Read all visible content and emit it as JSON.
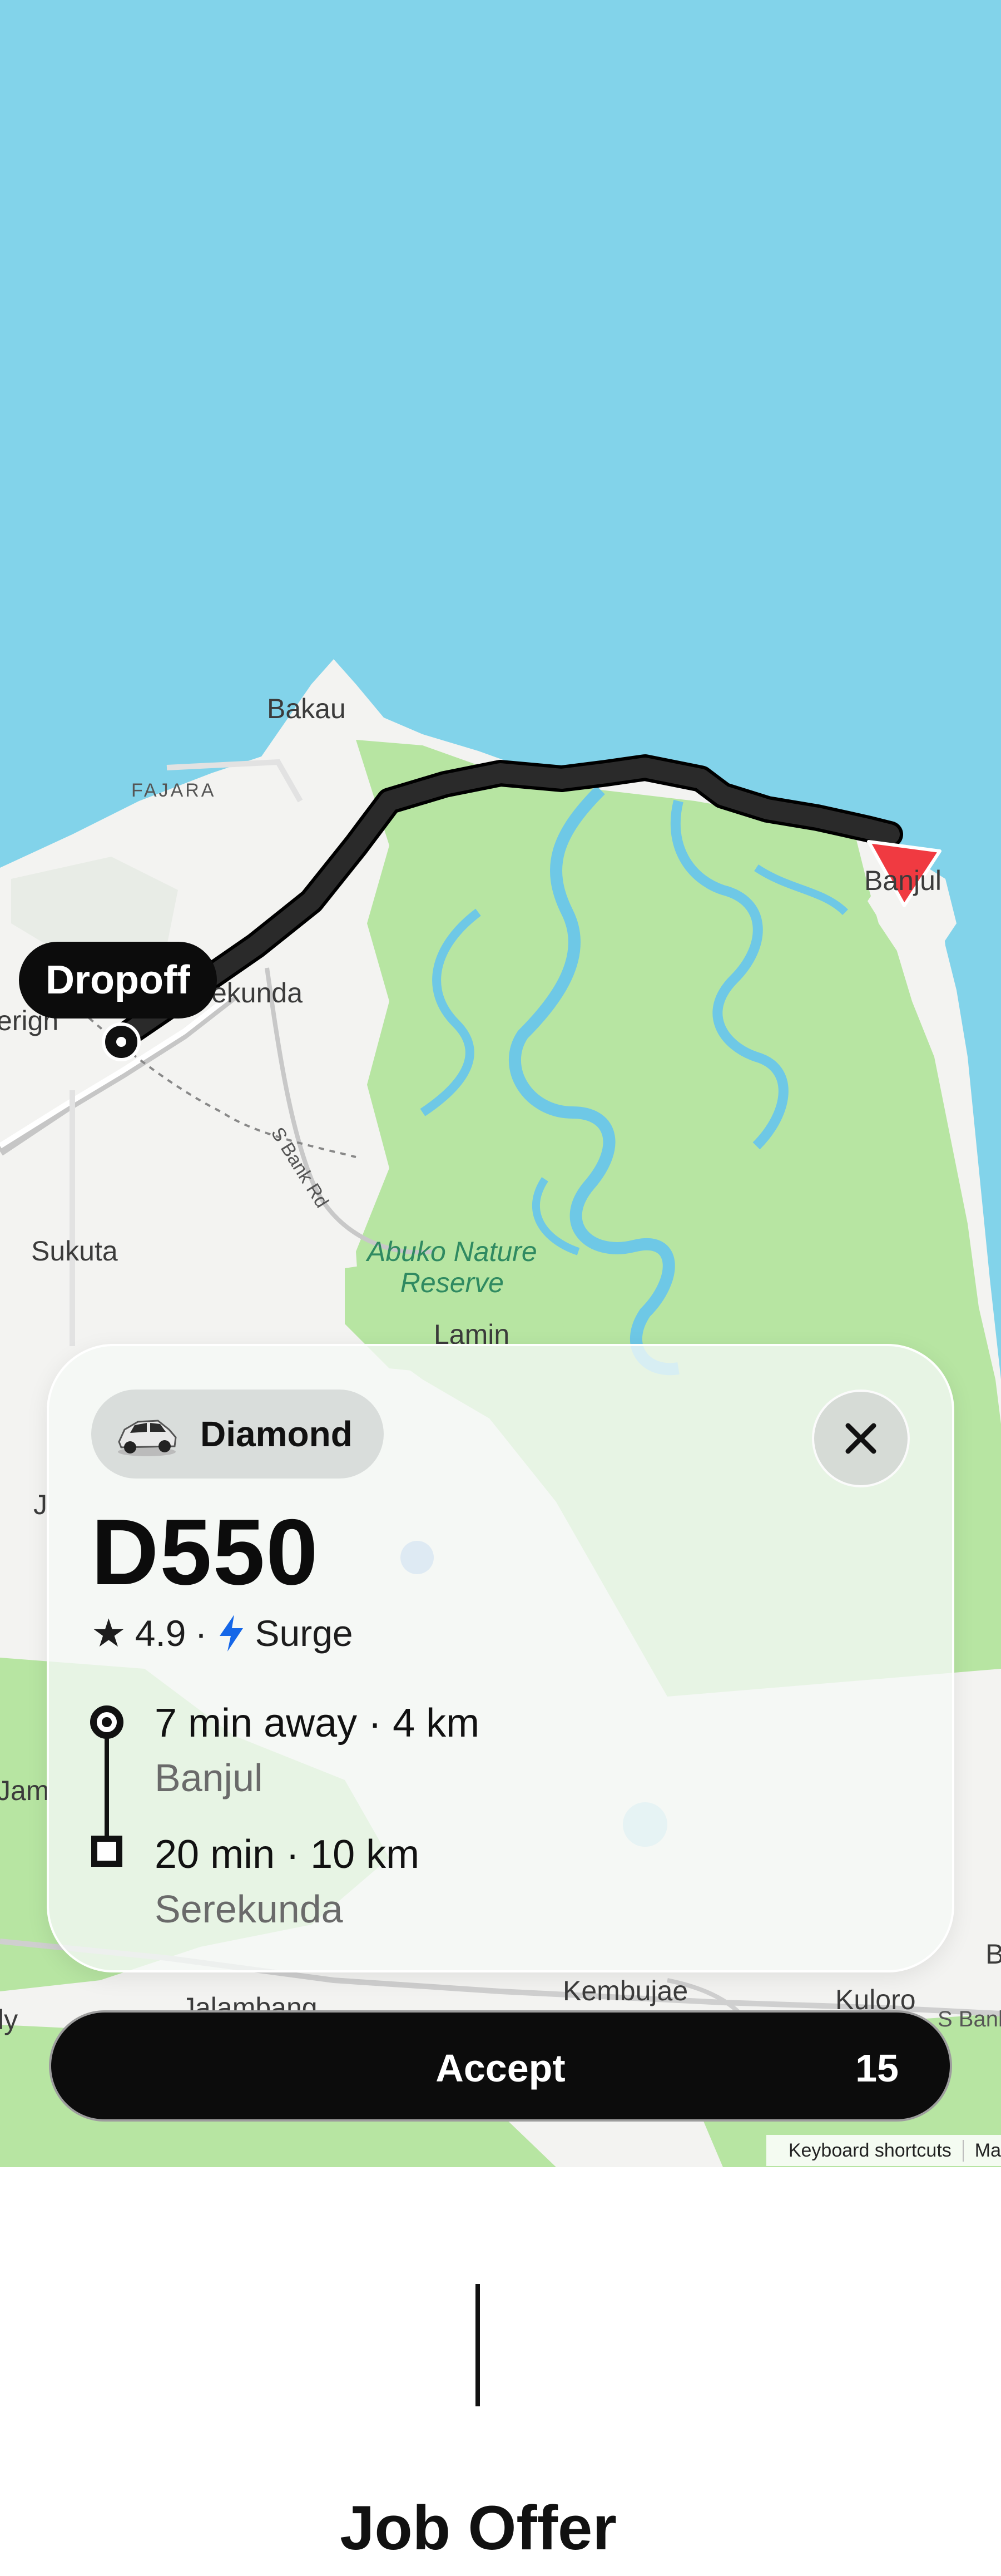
{
  "map": {
    "places": {
      "bakau": "Bakau",
      "fajara": "FAJARA",
      "serekunda_partial": "ekunda",
      "brikama_partial": "erigh",
      "banjul": "Banjul",
      "sukuta": "Sukuta",
      "abuko": "Abuko Nature\nReserve",
      "lamin": "Lamin",
      "kembujae": "Kembujae",
      "kuloro": "Kuloro",
      "jalambang": "Jalambang",
      "left_j": "J",
      "left_jam": "Jam",
      "left_ly": "ly",
      "right_b": "B",
      "road_sbank": "S Bank Rd",
      "road_sbank2": "S Bank"
    },
    "dropoff_label": "Dropoff",
    "footer": {
      "shortcuts": "Keyboard shortcuts",
      "data": "Ma"
    },
    "colors": {
      "water": "#82d3ea",
      "land": "#f2f2f0",
      "park": "#b6e6a1",
      "route": "#1b1b1b",
      "vehicle": "#f0393f"
    }
  },
  "offer": {
    "vehicle_class": "Diamond",
    "plate": "D550",
    "rating": "4.9",
    "separator": "·",
    "surge_label": "Surge",
    "pickup": {
      "eta": "7 min away · 4 km",
      "place": "Banjul"
    },
    "dropoff": {
      "eta": "20 min · 10 km",
      "place": "Serekunda"
    },
    "accept_label": "Accept",
    "accept_countdown": "15"
  },
  "page": {
    "title": "Job Offer"
  }
}
